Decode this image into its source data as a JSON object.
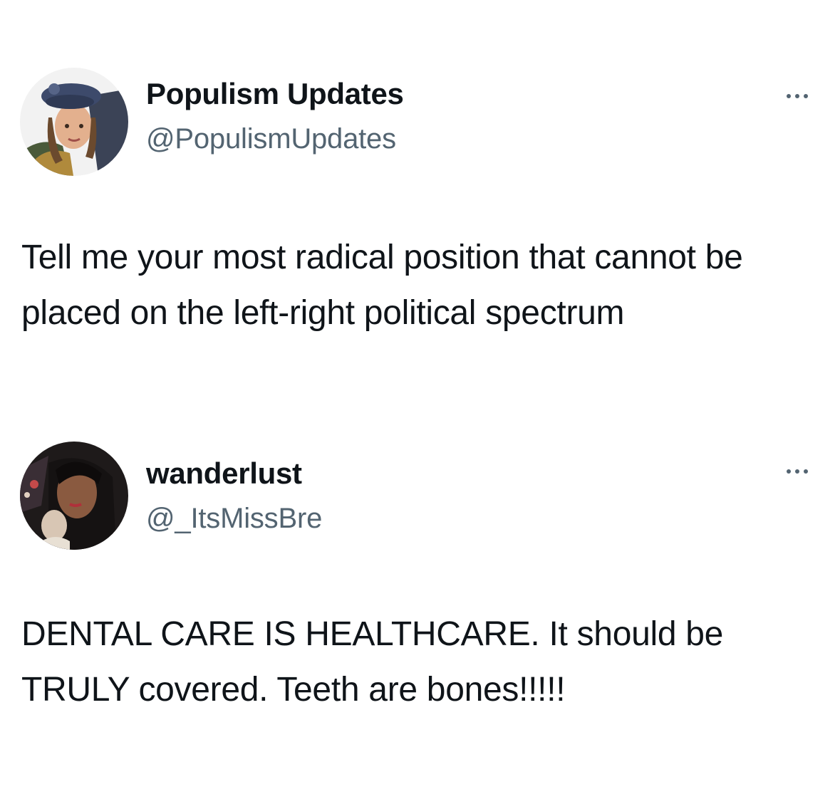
{
  "tweets": [
    {
      "display_name": "Populism Updates",
      "handle": "@PopulismUpdates",
      "text": "Tell me your most radical position that cannot be placed on the left-right political spectrum",
      "avatar_icon": "profile-photo-woman-in-beret",
      "more_icon": "more-horizontal-icon"
    },
    {
      "display_name": "wanderlust",
      "handle": "@_ItsMissBre",
      "text": "DENTAL CARE IS HEALTHCARE. It should be TRULY covered. Teeth are bones!!!!!",
      "avatar_icon": "profile-photo-woman-selfie",
      "more_icon": "more-horizontal-icon"
    }
  ],
  "colors": {
    "text_primary": "#0f1419",
    "text_secondary": "#536471",
    "background": "#ffffff"
  }
}
